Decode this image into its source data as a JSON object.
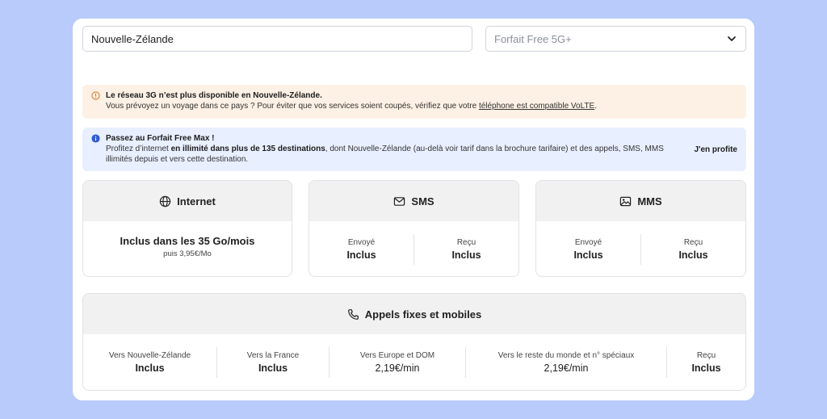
{
  "selectors": {
    "country_value": "Nouvelle-Zélande",
    "plan_placeholder": "Forfait Free 5G+"
  },
  "warning": {
    "title": "Le réseau 3G n’est plus disponible en Nouvelle-Zélande.",
    "text": "Vous prévoyez un voyage dans ce pays ? Pour éviter que vos services soient coupés, vérifiez que votre ",
    "link": "téléphone est compatible VoLTE",
    "end": "."
  },
  "info": {
    "title": "Passez au Forfait Free Max !",
    "text_a": "Profitez d’internet ",
    "text_bold": "en illimité dans plus de 135 destinations",
    "text_b": ", dont Nouvelle-Zélande (au-delà voir tarif dans la brochure tarifaire) et des appels, SMS, MMS illimités depuis et vers cette destination.",
    "cta": "J'en profite"
  },
  "internet": {
    "title": "Internet",
    "main": "Inclus dans les 35 Go/mois",
    "sub": "puis 3,95€/Mo"
  },
  "sms": {
    "title": "SMS",
    "sent_label": "Envoyé",
    "sent_value": "Inclus",
    "received_label": "Reçu",
    "received_value": "Inclus"
  },
  "mms": {
    "title": "MMS",
    "sent_label": "Envoyé",
    "sent_value": "Inclus",
    "received_label": "Reçu",
    "received_value": "Inclus"
  },
  "calls": {
    "title": "Appels fixes et mobiles",
    "cols": [
      {
        "label": "Vers Nouvelle-Zélande",
        "value": "Inclus"
      },
      {
        "label": "Vers la France",
        "value": "Inclus"
      },
      {
        "label": "Vers Europe et DOM",
        "value": "2,19€/min"
      },
      {
        "label": "Vers le reste du monde et n° spéciaux",
        "value": "2,19€/min"
      },
      {
        "label": "Reçu",
        "value": "Inclus"
      }
    ]
  },
  "icons": [
    "chevron-down-icon",
    "warning-icon",
    "info-icon",
    "globe-icon",
    "mail-icon",
    "image-icon",
    "phone-icon"
  ],
  "colors": {
    "background": "#b8cbfb",
    "warning_bg": "#fdf0e4",
    "warning_icon": "#e07a2e",
    "info_bg": "#e8efff",
    "info_icon": "#2f5bd3",
    "section_header_bg": "#f1f1f1"
  }
}
